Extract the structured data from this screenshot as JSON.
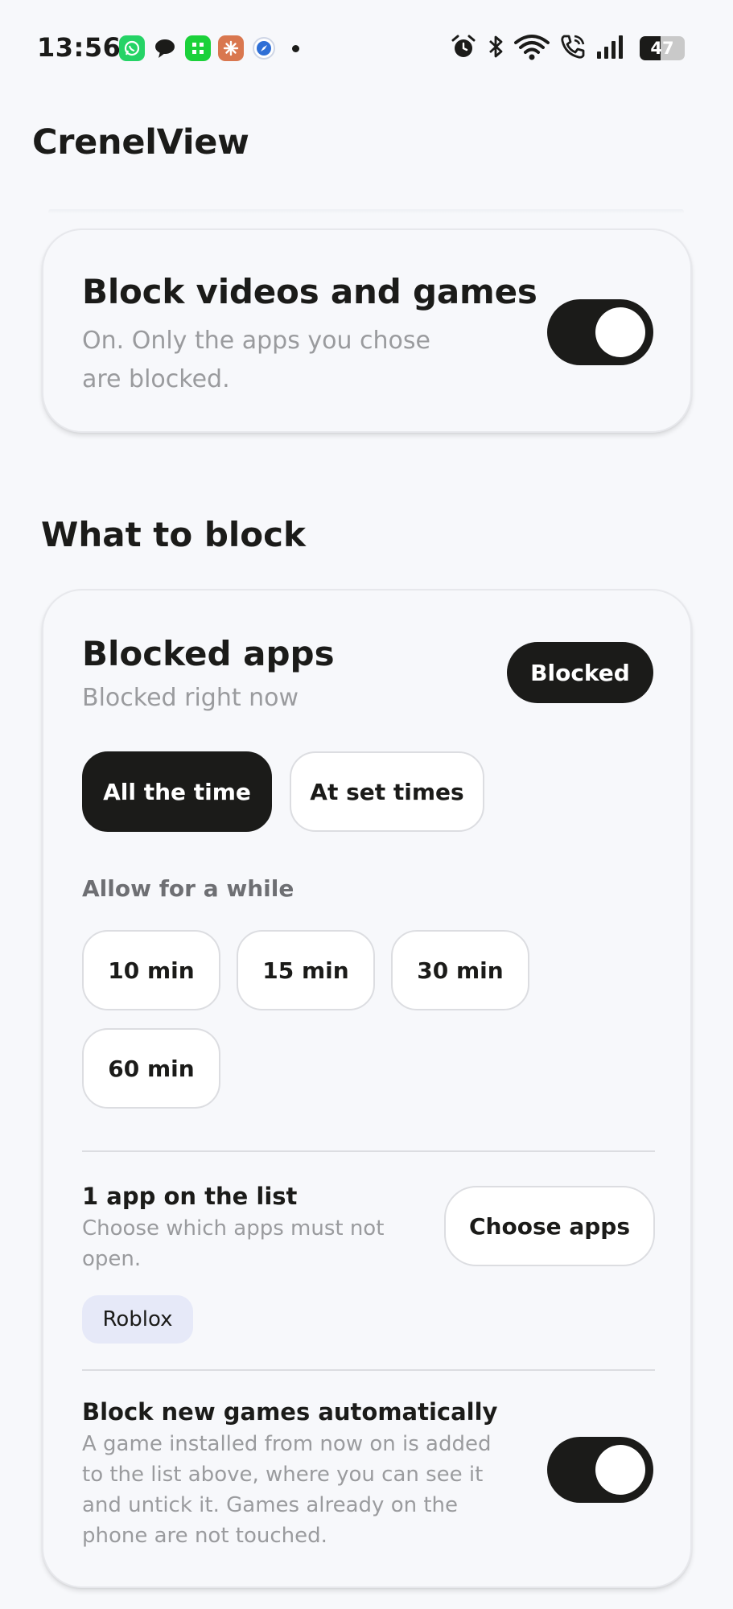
{
  "status_bar": {
    "time": "13:56",
    "notification_icons": [
      "whatsapp-icon",
      "chat-bubble-icon",
      "green-app-icon",
      "orange-app-icon",
      "compass-icon"
    ],
    "system_icons": [
      "alarm-icon",
      "bluetooth-icon",
      "wifi-icon",
      "call-icon",
      "signal-icon"
    ],
    "battery_level": "47"
  },
  "app": {
    "title": "CrenelView"
  },
  "main_toggle": {
    "heading": "Block videos and games",
    "subtitle": "On. Only the apps you chose are blocked.",
    "state": "on"
  },
  "section": {
    "title": "What to block"
  },
  "blocked_apps": {
    "heading": "Blocked apps",
    "subtitle": "Blocked right now",
    "status": "Blocked",
    "modes": [
      {
        "label": "All the time",
        "selected": true
      },
      {
        "label": "At set times",
        "selected": false
      }
    ],
    "allow_label": "Allow for a while",
    "durations": [
      "10 min",
      "15 min",
      "30 min",
      "60 min"
    ],
    "list_heading": "1 app on the list",
    "list_subtitle": "Choose which apps must not open.",
    "choose_button": "Choose apps",
    "apps": [
      "Roblox"
    ],
    "auto_heading": "Block new games automatically",
    "auto_subtitle": "A game installed from now on is added to the list above, where you can see it and untick it. Games already on the phone are not touched.",
    "auto_state": "on"
  },
  "colors": {
    "background": "#f7f8fb",
    "dark": "#1b1b19",
    "muted_text": "#9a9b9e",
    "chip": "#e6e9f8"
  }
}
